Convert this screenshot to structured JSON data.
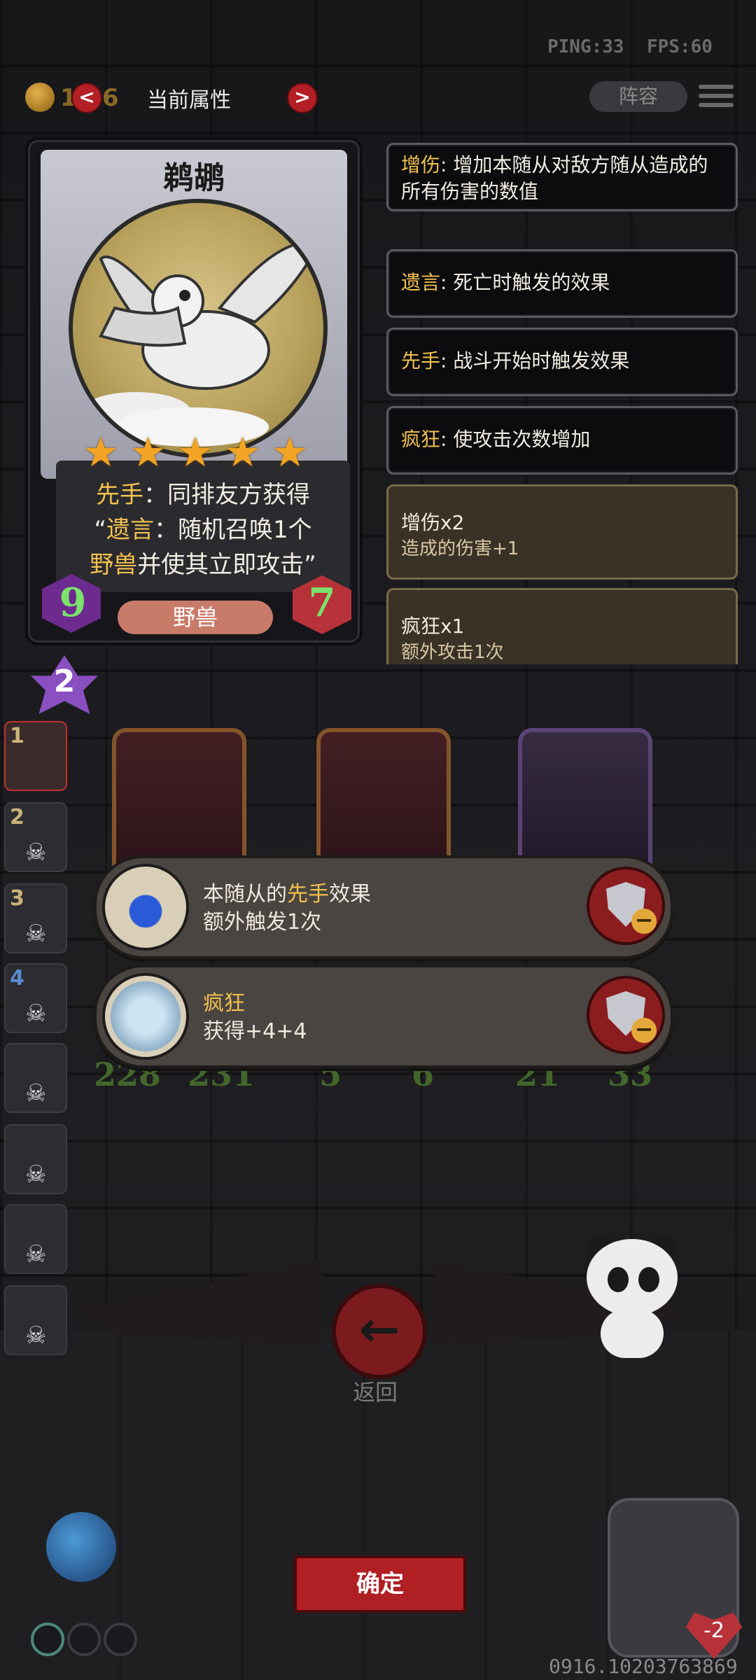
{
  "hud": {
    "ping": "PING:33",
    "fps": "FPS:60"
  },
  "top_bar": {
    "coin_count_partial": "1",
    "coin_count_tail": "6",
    "prev_arrow": "<",
    "title": "当前属性",
    "next_arrow": ">",
    "lineup_label": "阵容"
  },
  "card": {
    "name": "鹈鹕",
    "stars": 5,
    "desc_line1_kw": "先手",
    "desc_line1_rest": "：同排友方获得",
    "desc_line2_quote": "“",
    "desc_line2_kw": "遗言",
    "desc_line2_rest": "：随机召唤1个",
    "desc_line3_kw": "野兽",
    "desc_line3_rest": "并使其立即攻击”",
    "attack": "9",
    "health": "7",
    "tribe": "野兽",
    "tier": "2"
  },
  "keywords": [
    {
      "name": "增伤",
      "text": ": 增加本随从对敌方随从造成的所有伤害的数值"
    },
    {
      "name": "遗言",
      "text": ": 死亡时触发的效果"
    },
    {
      "name": "先手",
      "text": ": 战斗开始时触发效果"
    },
    {
      "name": "疯狂",
      "text": ": 使攻击次数增加"
    }
  ],
  "buffs": [
    {
      "title": "增伤x2",
      "sub": "造成的伤害+1"
    },
    {
      "title": "疯狂x1",
      "sub": "额外攻击1次"
    }
  ],
  "side_slots": [
    "1",
    "2",
    "3",
    "4",
    "",
    "",
    "",
    ""
  ],
  "board_stats": [
    {
      "atk": "228",
      "hp": "231"
    },
    {
      "atk": "5",
      "hp": "6"
    },
    {
      "atk": "21",
      "hp": "33"
    }
  ],
  "effects": [
    {
      "line1_pre": "本随从的",
      "line1_kw": "先手",
      "line1_post": "效果",
      "line2": "额外触发1次"
    },
    {
      "line1_pre": "",
      "line1_kw": "疯狂",
      "line1_post": "",
      "line2": "获得+4+4"
    }
  ],
  "back": {
    "arrow": "←",
    "label": "返回"
  },
  "confirm_label": "确定",
  "hero_hp": "-2",
  "version": "0916.10203763869"
}
